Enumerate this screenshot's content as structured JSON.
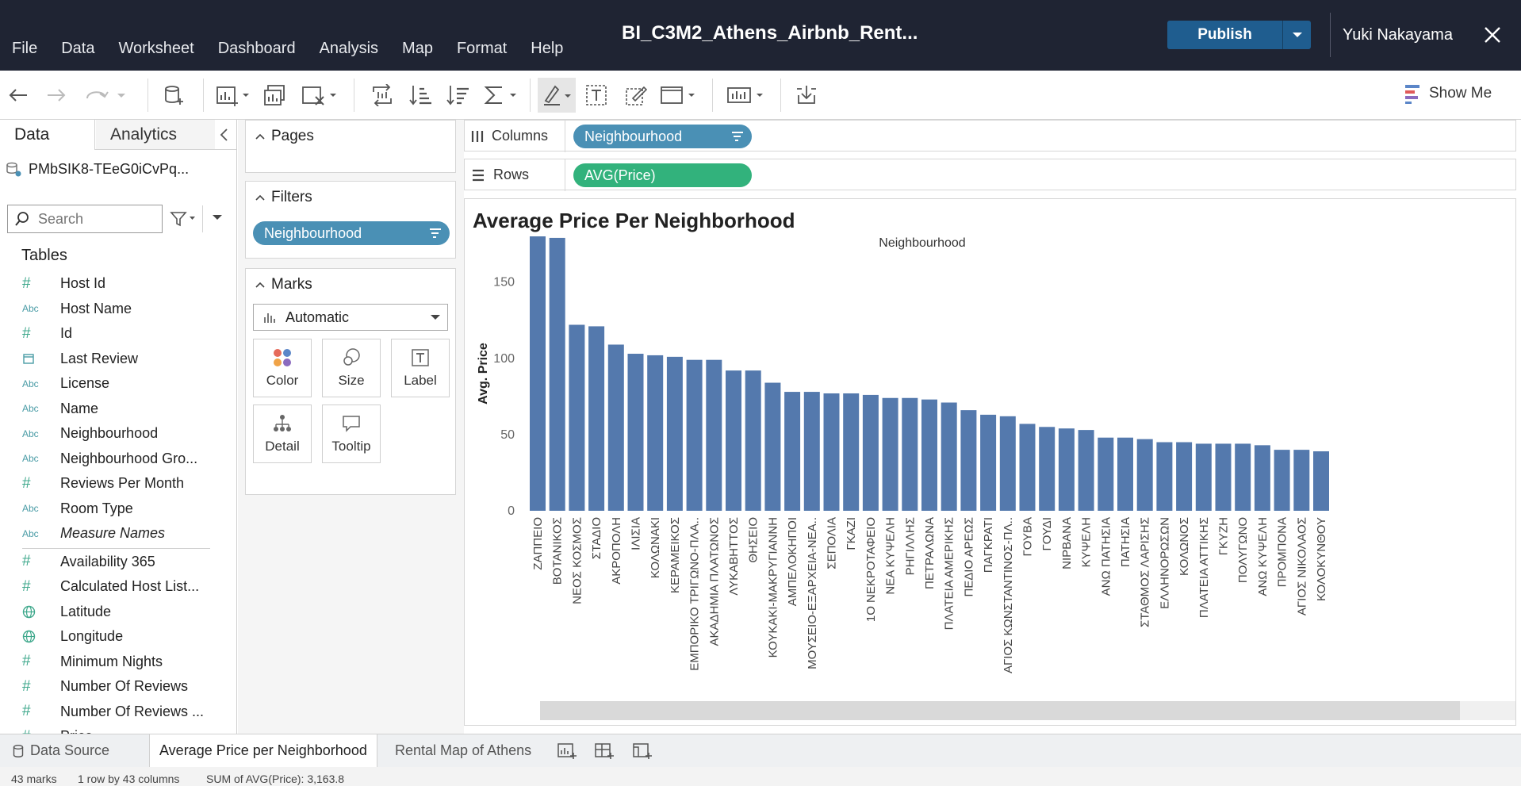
{
  "window": {
    "title": "BI_C3M2_Athens_Airbnb_Rent...",
    "publish_label": "Publish",
    "user": "Yuki Nakayama"
  },
  "menu": [
    "File",
    "Data",
    "Worksheet",
    "Dashboard",
    "Analysis",
    "Map",
    "Format",
    "Help"
  ],
  "toolbar": {
    "show_me_label": "Show Me"
  },
  "data_pane": {
    "tab_data": "Data",
    "tab_analytics": "Analytics",
    "datasource": "PMbSIK8-TEeG0iCvPq...",
    "search_placeholder": "Search",
    "tables_label": "Tables",
    "fields": [
      {
        "icon": "#",
        "name": "Host Id",
        "type": "number"
      },
      {
        "icon": "Abc",
        "name": "Host Name",
        "type": "string"
      },
      {
        "icon": "#",
        "name": "Id",
        "type": "number"
      },
      {
        "icon": "cal",
        "name": "Last Review",
        "type": "date"
      },
      {
        "icon": "Abc",
        "name": "License",
        "type": "string"
      },
      {
        "icon": "Abc",
        "name": "Name",
        "type": "string"
      },
      {
        "icon": "Abc",
        "name": "Neighbourhood",
        "type": "string"
      },
      {
        "icon": "Abc",
        "name": "Neighbourhood Gro...",
        "type": "string"
      },
      {
        "icon": "#",
        "name": "Reviews Per Month",
        "type": "number"
      },
      {
        "icon": "Abc",
        "name": "Room Type",
        "type": "string"
      },
      {
        "icon": "Abc",
        "name": "Measure Names",
        "type": "string",
        "italic": true
      }
    ],
    "measures": [
      {
        "icon": "#",
        "name": "Availability 365",
        "type": "number"
      },
      {
        "icon": "#",
        "name": "Calculated Host List...",
        "type": "number"
      },
      {
        "icon": "globe",
        "name": "Latitude",
        "type": "geo"
      },
      {
        "icon": "globe",
        "name": "Longitude",
        "type": "geo"
      },
      {
        "icon": "#",
        "name": "Minimum Nights",
        "type": "number"
      },
      {
        "icon": "#",
        "name": "Number Of Reviews",
        "type": "number"
      },
      {
        "icon": "#",
        "name": "Number Of Reviews ...",
        "type": "number"
      },
      {
        "icon": "#",
        "name": "Price",
        "type": "number"
      }
    ]
  },
  "cards": {
    "pages_label": "Pages",
    "filters_label": "Filters",
    "filter_pill": "Neighbourhood",
    "marks_label": "Marks",
    "mark_type": "Automatic",
    "mark_buttons": [
      "Color",
      "Size",
      "Label",
      "Detail",
      "Tooltip"
    ]
  },
  "shelves": {
    "columns_label": "Columns",
    "columns_pill": "Neighbourhood",
    "rows_label": "Rows",
    "rows_pill": "AVG(Price)"
  },
  "viz": {
    "title": "Average Price Per Neighborhood"
  },
  "colors": {
    "bar": "#5479ad",
    "pill_dim": "#4a90b5",
    "pill_measure": "#32b27c",
    "topbar": "#1f2433"
  },
  "chart_data": {
    "type": "bar",
    "title": "Average Price Per Neighborhood",
    "xlabel": "Neighbourhood",
    "ylabel": "Avg. Price",
    "ylim": [
      0,
      180
    ],
    "yticks": [
      0,
      50,
      100,
      150
    ],
    "grid": false,
    "categories": [
      "ΖΑΠΠΕΙΟ",
      "ΒΟΤΑΝΙΚΟΣ",
      "ΝΕΟΣ ΚΟΣΜΟΣ",
      "ΣΤΑΔΙΟ",
      "ΑΚΡΟΠΟΛΗ",
      "ΙΛΙΣΙΑ",
      "ΚΟΛΩΝΑΚΙ",
      "ΚΕΡΑΜΕΙΚΟΣ",
      "ΕΜΠΟΡΙΚΟ ΤΡΙΓΩΝΟ-ΠΛΑ..",
      "ΑΚΑΔΗΜΙΑ ΠΛΑΤΩΝΟΣ",
      "ΛΥΚΑΒΗΤΤΟΣ",
      "ΘΗΣΕΙΟ",
      "ΚΟΥΚΑΚΙ-ΜΑΚΡΥΓΙΑΝΝΗ",
      "ΑΜΠΕΛΟΚΗΠΟΙ",
      "ΜΟΥΣΕΙΟ-ΕΞΑΡΧΕΙΑ-ΝΕΑ..",
      "ΣΕΠΟΛΙΑ",
      "ΓΚΑΖΙ",
      "1Ο ΝΕΚΡΟΤΑΦΕΙΟ",
      "ΝΕΑ ΚΥΨΕΛΗ",
      "ΡΗΓΙΛΛΗΣ",
      "ΠΕΤΡΑΛΩΝΑ",
      "ΠΛΑΤΕΙΑ ΑΜΕΡΙΚΗΣ",
      "ΠΕΔΙΟ ΑΡΕΩΣ",
      "ΠΑΓΚΡΑΤΙ",
      "ΑΓΙΟΣ ΚΩΝΣΤΑΝΤΙΝΟΣ-ΠΛ..",
      "ΓΟΥΒΑ",
      "ΓΟΥΔΙ",
      "ΝΙΡΒΑΝΑ",
      "ΚΥΨΕΛΗ",
      "ΑΝΩ ΠΑΤΗΣΙΑ",
      "ΠΑΤΗΣΙΑ",
      "ΣΤΑΘΜΟΣ ΛΑΡΙΣΗΣ",
      "ΕΛΛΗΝΟΡΩΣΩΝ",
      "ΚΟΛΩΝΟΣ",
      "ΠΛΑΤΕΙΑ ΑΤΤΙΚΗΣ",
      "ΓΚΥΖΗ",
      "ΠΟΛΥΓΩΝΟ",
      "ΑΝΩ ΚΥΨΕΛΗ",
      "ΠΡΟΜΠΟΝΑ",
      "ΑΓΙΟΣ ΝΙΚΟΛΑΟΣ",
      "ΚΟΛΟΚΥΝΘΟΥ"
    ],
    "values": [
      180,
      179,
      122,
      121,
      109,
      103,
      102,
      101,
      99,
      99,
      92,
      92,
      84,
      78,
      78,
      77,
      77,
      76,
      74,
      74,
      73,
      71,
      66,
      63,
      62,
      57,
      55,
      54,
      53,
      48,
      48,
      47,
      45,
      45,
      44,
      44,
      44,
      43,
      40,
      40,
      39
    ]
  },
  "sheet_tabs": {
    "data_source": "Data Source",
    "active": "Average Price per Neighborhood",
    "other": "Rental Map of Athens"
  },
  "status": {
    "marks": "43 marks",
    "rows_cols": "1 row by 43 columns",
    "sum": "SUM of AVG(Price): 3,163.8"
  }
}
